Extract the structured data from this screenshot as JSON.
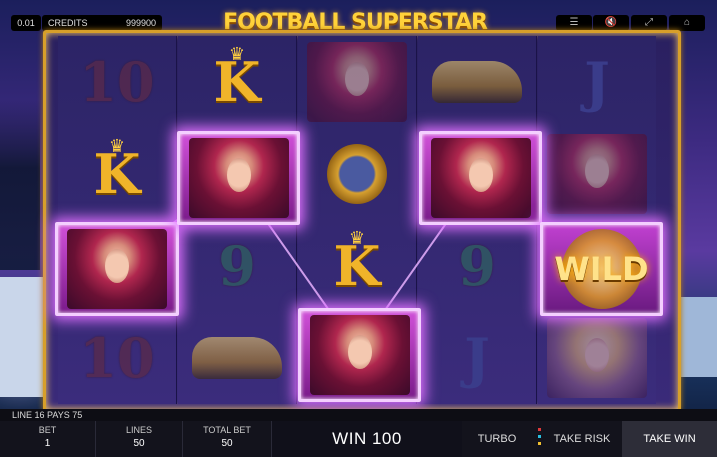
{
  "header": {
    "bet_value": "0.01",
    "credits_label": "CREDITS",
    "credits_value": "999900",
    "title": "FOOTBALL SUPERSTAR",
    "controls": [
      "menu-icon",
      "sound-off-icon",
      "fullscreen-icon",
      "home-icon"
    ]
  },
  "reels": {
    "win_value_label": "75"
  },
  "status": {
    "line_pays": "LINE 16 PAYS 75"
  },
  "footer": {
    "bet_label": "BET",
    "bet_value": "1",
    "lines_label": "LINES",
    "lines_value": "50",
    "total_bet_label": "TOTAL BET",
    "total_bet_value": "50",
    "win_text": "WIN 100",
    "turbo_label": "TURBO",
    "take_risk_label": "TAKE RISK",
    "take_win_label": "TAKE WIN",
    "risk_dot_colors": [
      "#e03a3a",
      "#2ac0e0",
      "#f0c030"
    ]
  },
  "symbols": {
    "ten": "10",
    "nine": "9",
    "jack": "J",
    "king": "K",
    "wild": "WILD"
  }
}
